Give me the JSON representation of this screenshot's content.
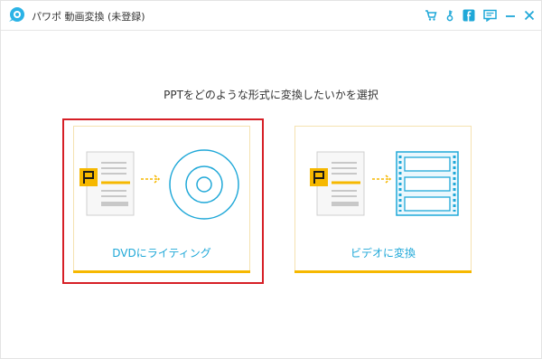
{
  "window": {
    "title": "パワポ 動画変換 (未登録)",
    "accent": "#1fa8d8",
    "toolbar_buttons": [
      {
        "name": "cart-icon"
      },
      {
        "name": "key-icon"
      },
      {
        "name": "facebook-icon"
      },
      {
        "name": "feedback-icon"
      },
      {
        "name": "minimize-icon"
      },
      {
        "name": "close-icon"
      }
    ]
  },
  "main": {
    "prompt": "PPTをどのような形式に変換したいかを選択",
    "options": [
      {
        "label": "DVDにライティング",
        "icon": "disc-icon",
        "selected": true
      },
      {
        "label": "ビデオに変換",
        "icon": "film-strip-icon",
        "selected": false
      }
    ]
  },
  "colors": {
    "selection_border": "#d61f26",
    "card_bar": "#f6b800",
    "ppt_orange": "#f6b800",
    "blue": "#1fa8d8"
  }
}
